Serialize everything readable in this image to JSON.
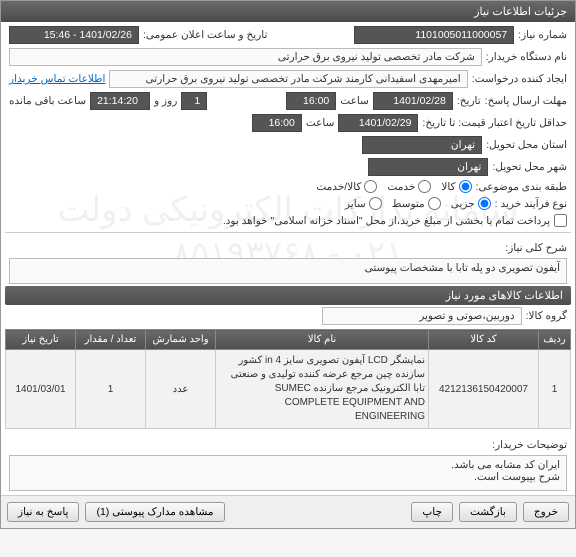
{
  "window_title": "جزئیات اطلاعات نیاز",
  "labels": {
    "need_no": "شماره نیاز:",
    "announce": "تاریخ و ساعت اعلان عمومی:",
    "buyer": "نام دستگاه خریدار:",
    "creator": "ایجاد کننده درخواست:",
    "contact": "اطلاعات تماس خریدار",
    "deadline": "مهلت ارسال پاسخ:",
    "date_word": "تاریخ:",
    "hour_word": "ساعت",
    "day_hour": "روز و",
    "remaining": "ساعت باقی مانده",
    "min_valid": "حداقل تاریخ اعتبار قیمت: تا تاریخ:",
    "province": "استان محل تحویل:",
    "city": "شهر محل تحویل:",
    "category": "طبقه بندی موضوعی:",
    "buy_type": "نوع فرآیند خرید :",
    "pay_note": "پرداخت تمام یا بخشی از مبلغ خرید،از محل \"اسناد خزانه اسلامی\" خواهد بود.",
    "need_desc": "شرح کلی نیاز:",
    "goods_info": "اطلاعات کالاهای مورد نیاز",
    "goods_group": "گروه کالا:",
    "buyer_notes": "توضیحات خریدار:"
  },
  "fields": {
    "need_no": "1101005011000057",
    "announce": "1401/02/26 - 15:46",
    "buyer": "شرکت مادر تخصصی تولید نیروی برق حرارتی",
    "creator": "امیرمهدی اسفیدانی کارمند شرکت مادر تخصصی تولید نیروی برق حرارتی",
    "deadline_date": "1401/02/28",
    "deadline_time": "16:00",
    "remain_days": "1",
    "remain_time": "21:14:20",
    "valid_date": "1401/02/29",
    "valid_time": "16:00",
    "province": "تهران",
    "city": "تهران",
    "need_desc": "آیفون تصویری دو پله تابا با مشخصات پیوستی",
    "goods_group": "دوربین،صوتی و تصویر",
    "buyer_notes": "ایران کد مشابه می باشد.\nشرح بپیوست است."
  },
  "radios": {
    "cat": {
      "goods": "کالا",
      "service": "خدمت",
      "both": "کالا/خدمت"
    },
    "buy": {
      "small": "جزیی",
      "medium": "متوسط",
      "other": "سایر"
    }
  },
  "table": {
    "headers": {
      "row": "ردیف",
      "code": "کد کالا",
      "name": "نام کالا",
      "unit": "واحد شمارش",
      "qty": "تعداد / مقدار",
      "date": "تاریخ نیاز"
    },
    "rows": [
      {
        "row": "1",
        "code": "4212136150420007",
        "name": "نمایشگر LCD آیفون تصویری سایز in 4 کشور سازنده چین مرجع عرضه کننده تولیدی و صنعتی تابا الکترونیک مرجع سازنده SUMEC COMPLETE EQUIPMENT AND ENGINEERING",
        "unit": "عدد",
        "qty": "1",
        "date": "1401/03/01"
      }
    ]
  },
  "buttons": {
    "back": "بازگشت",
    "exit": "خروج",
    "print": "چاپ",
    "attach": "مشاهده مدارک پیوستی (1)",
    "respond": "پاسخ به نیاز"
  },
  "watermark": "سامانه تدارکات الکترونیکی دولت\n۰۲۱ - ۸۵۱۹۳۷۶۸",
  "chart_data": null
}
